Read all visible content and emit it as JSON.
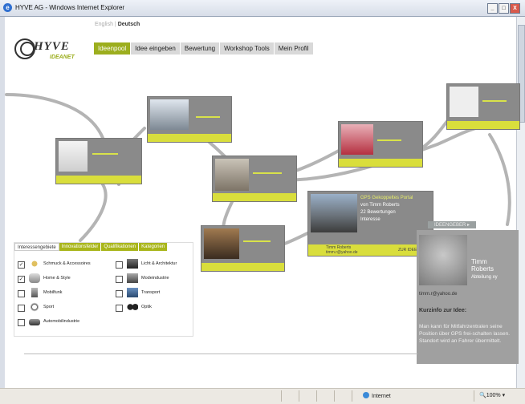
{
  "window": {
    "title": "HYVE AG - Windows Internet Explorer",
    "buttons": [
      "_",
      "□",
      "X"
    ]
  },
  "language": {
    "english": "English",
    "separator": "|",
    "deutsch": "Deutsch"
  },
  "logo": {
    "word": "HYVE",
    "sub": "IDEANET"
  },
  "nav": {
    "tabs": [
      "Ideenpool",
      "Idee eingeben",
      "Bewertung",
      "Workshop Tools",
      "Mein Profil"
    ],
    "active": "Ideenpool"
  },
  "featured_idea": {
    "title": "GPS Gekoppeltes Portal",
    "author_line": "von Timm Roberts",
    "ratings": "22 Bewertungen",
    "interest_label": "Interesse",
    "footer_name": "Timm Roberts",
    "footer_contact": "timm.r@yahoo.de",
    "footer_action": "ZUR IDEE ▸"
  },
  "profile": {
    "tab": "IDEENGEBER ▸",
    "name": "Timm\nRoberts",
    "department": "Abteilung xy",
    "email": "timm.r@yahoo.de",
    "heading": "Kurzinfo zur Idee:",
    "description": "Man kann für Mitfahrzentralen seine Position über GPS frei-schalten lassen. Standort wird an Fahrer übermittelt."
  },
  "filter": {
    "tabs": [
      "Interessengebiete",
      "Innovationsfelder",
      "Qualifikationen",
      "Kategorien"
    ],
    "active_tab": "Interessengebiete",
    "items_left": [
      {
        "label": "Schmuck & Accessoires",
        "checked": true
      },
      {
        "label": "Home & Style",
        "checked": true
      },
      {
        "label": "Mobilfunk",
        "checked": false
      },
      {
        "label": "Sport",
        "checked": false
      },
      {
        "label": "Automobilindustrie",
        "checked": false
      }
    ],
    "items_right": [
      {
        "label": "Licht & Architektur",
        "checked": false
      },
      {
        "label": "Modeindustrie",
        "checked": false
      },
      {
        "label": "Transport",
        "checked": false
      },
      {
        "label": "Optik",
        "checked": false
      }
    ]
  },
  "statusbar": {
    "zone": "Internet",
    "zoom": "100%"
  },
  "colors": {
    "accent_green": "#9cae1e",
    "card_grey": "#8a8a8a",
    "card_footer": "#d9de3c"
  }
}
